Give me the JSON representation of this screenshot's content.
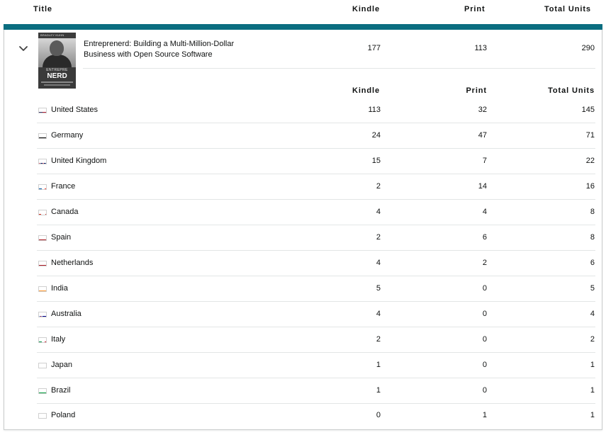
{
  "header": {
    "title": "Title",
    "kindle": "Kindle",
    "print": "Print",
    "total": "Total Units"
  },
  "book": {
    "title": "Entreprenerd: Building a Multi-Million-Dollar Business with Open Source Software",
    "kindle": "177",
    "print": "113",
    "total": "290",
    "cover": {
      "top_text": "BRADLEY KUHN",
      "line1": "ENTREPRE",
      "line2": "NERD"
    }
  },
  "sub_header": {
    "kindle": "Kindle",
    "print": "Print",
    "total": "Total Units"
  },
  "countries": [
    {
      "name": "United States",
      "kindle": "113",
      "print": "32",
      "total": "145",
      "flag": "us-flag-icon"
    },
    {
      "name": "Germany",
      "kindle": "24",
      "print": "47",
      "total": "71",
      "flag": "de-flag-icon"
    },
    {
      "name": "United Kingdom",
      "kindle": "15",
      "print": "7",
      "total": "22",
      "flag": "gb-flag-icon"
    },
    {
      "name": "France",
      "kindle": "2",
      "print": "14",
      "total": "16",
      "flag": "fr-flag-icon"
    },
    {
      "name": "Canada",
      "kindle": "4",
      "print": "4",
      "total": "8",
      "flag": "ca-flag-icon"
    },
    {
      "name": "Spain",
      "kindle": "2",
      "print": "6",
      "total": "8",
      "flag": "es-flag-icon"
    },
    {
      "name": "Netherlands",
      "kindle": "4",
      "print": "2",
      "total": "6",
      "flag": "nl-flag-icon"
    },
    {
      "name": "India",
      "kindle": "5",
      "print": "0",
      "total": "5",
      "flag": "in-flag-icon"
    },
    {
      "name": "Australia",
      "kindle": "4",
      "print": "0",
      "total": "4",
      "flag": "au-flag-icon"
    },
    {
      "name": "Italy",
      "kindle": "2",
      "print": "0",
      "total": "2",
      "flag": "it-flag-icon"
    },
    {
      "name": "Japan",
      "kindle": "1",
      "print": "0",
      "total": "1",
      "flag": "jp-flag-icon"
    },
    {
      "name": "Brazil",
      "kindle": "1",
      "print": "0",
      "total": "1",
      "flag": "br-flag-icon"
    },
    {
      "name": "Poland",
      "kindle": "0",
      "print": "1",
      "total": "1",
      "flag": "pl-flag-icon"
    }
  ],
  "colors": {
    "accent": "#0b6e80",
    "divider": "#e3e6e6",
    "text": "#0f1111"
  }
}
